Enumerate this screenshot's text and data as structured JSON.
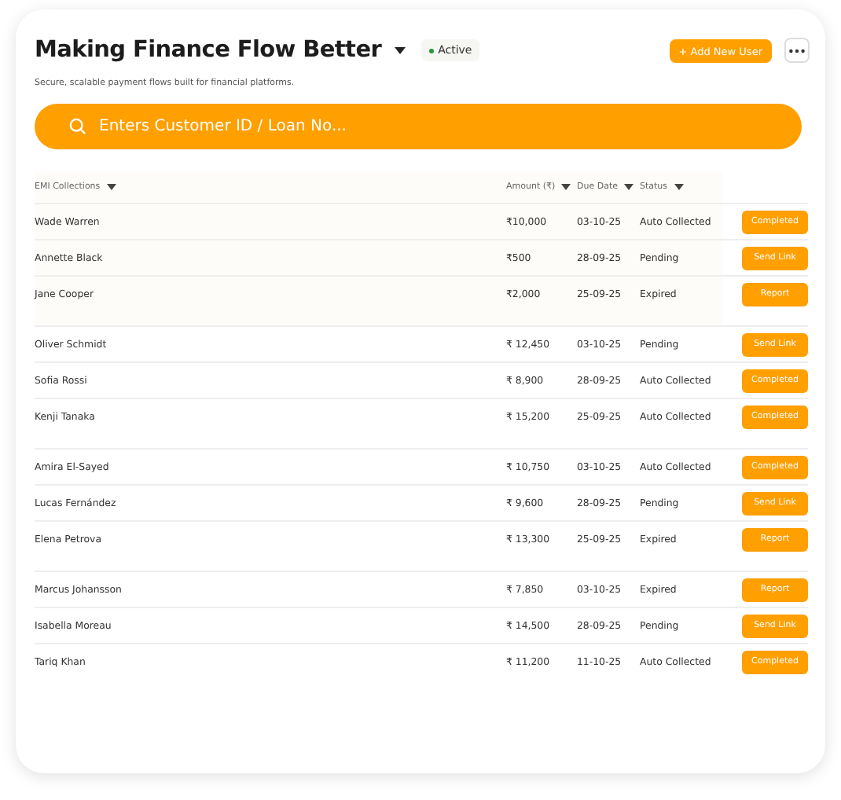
{
  "header": {
    "title": "Making Finance Flow Better",
    "status": "Active",
    "subtitle": "Secure, scalable payment flows built for financial platforms.",
    "add_button": "+ Add New User"
  },
  "search": {
    "placeholder": "Enters Customer ID / Loan No..."
  },
  "table": {
    "columns": [
      "EMI Collections",
      "Amount (₹)",
      "Due Date",
      "Status"
    ],
    "groups": [
      {
        "highlighted": true,
        "rows": [
          {
            "name": "Wade Warren",
            "amount": "₹10,000",
            "due": "03-10-25",
            "status": "Auto Collected",
            "action": "Completed"
          },
          {
            "name": "Annette Black",
            "amount": "₹500",
            "due": "28-09-25",
            "status": "Pending",
            "action": "Send Link"
          },
          {
            "name": "Jane Cooper",
            "amount": "₹2,000",
            "due": "25-09-25",
            "status": "Expired",
            "action": "Report"
          }
        ]
      },
      {
        "highlighted": false,
        "rows": [
          {
            "name": "Oliver Schmidt",
            "amount": "₹ 12,450",
            "due": "03-10-25",
            "status": "Pending",
            "action": "Send Link"
          },
          {
            "name": "Sofia Rossi",
            "amount": "₹ 8,900",
            "due": "28-09-25",
            "status": "Auto Collected",
            "action": "Completed"
          },
          {
            "name": "Kenji Tanaka",
            "amount": "₹ 15,200",
            "due": "25-09-25",
            "status": "Auto Collected",
            "action": "Completed"
          }
        ]
      },
      {
        "highlighted": false,
        "rows": [
          {
            "name": "Amira El-Sayed",
            "amount": "₹ 10,750",
            "due": "03-10-25",
            "status": "Auto Collected",
            "action": "Completed"
          },
          {
            "name": "Lucas Fernández",
            "amount": "₹ 9,600",
            "due": "28-09-25",
            "status": "Pending",
            "action": "Send Link"
          },
          {
            "name": "Elena Petrova",
            "amount": "₹ 13,300",
            "due": "25-09-25",
            "status": "Expired",
            "action": "Report"
          }
        ]
      },
      {
        "highlighted": false,
        "rows": [
          {
            "name": "Marcus Johansson",
            "amount": "₹ 7,850",
            "due": "03-10-25",
            "status": "Expired",
            "action": "Report"
          },
          {
            "name": "Isabella Moreau",
            "amount": "₹ 14,500",
            "due": "28-09-25",
            "status": "Pending",
            "action": "Send Link"
          },
          {
            "name": "Tariq Khan",
            "amount": "₹ 11,200",
            "due": "11-10-25",
            "status": "Auto Collected",
            "action": "Completed"
          }
        ]
      }
    ]
  }
}
